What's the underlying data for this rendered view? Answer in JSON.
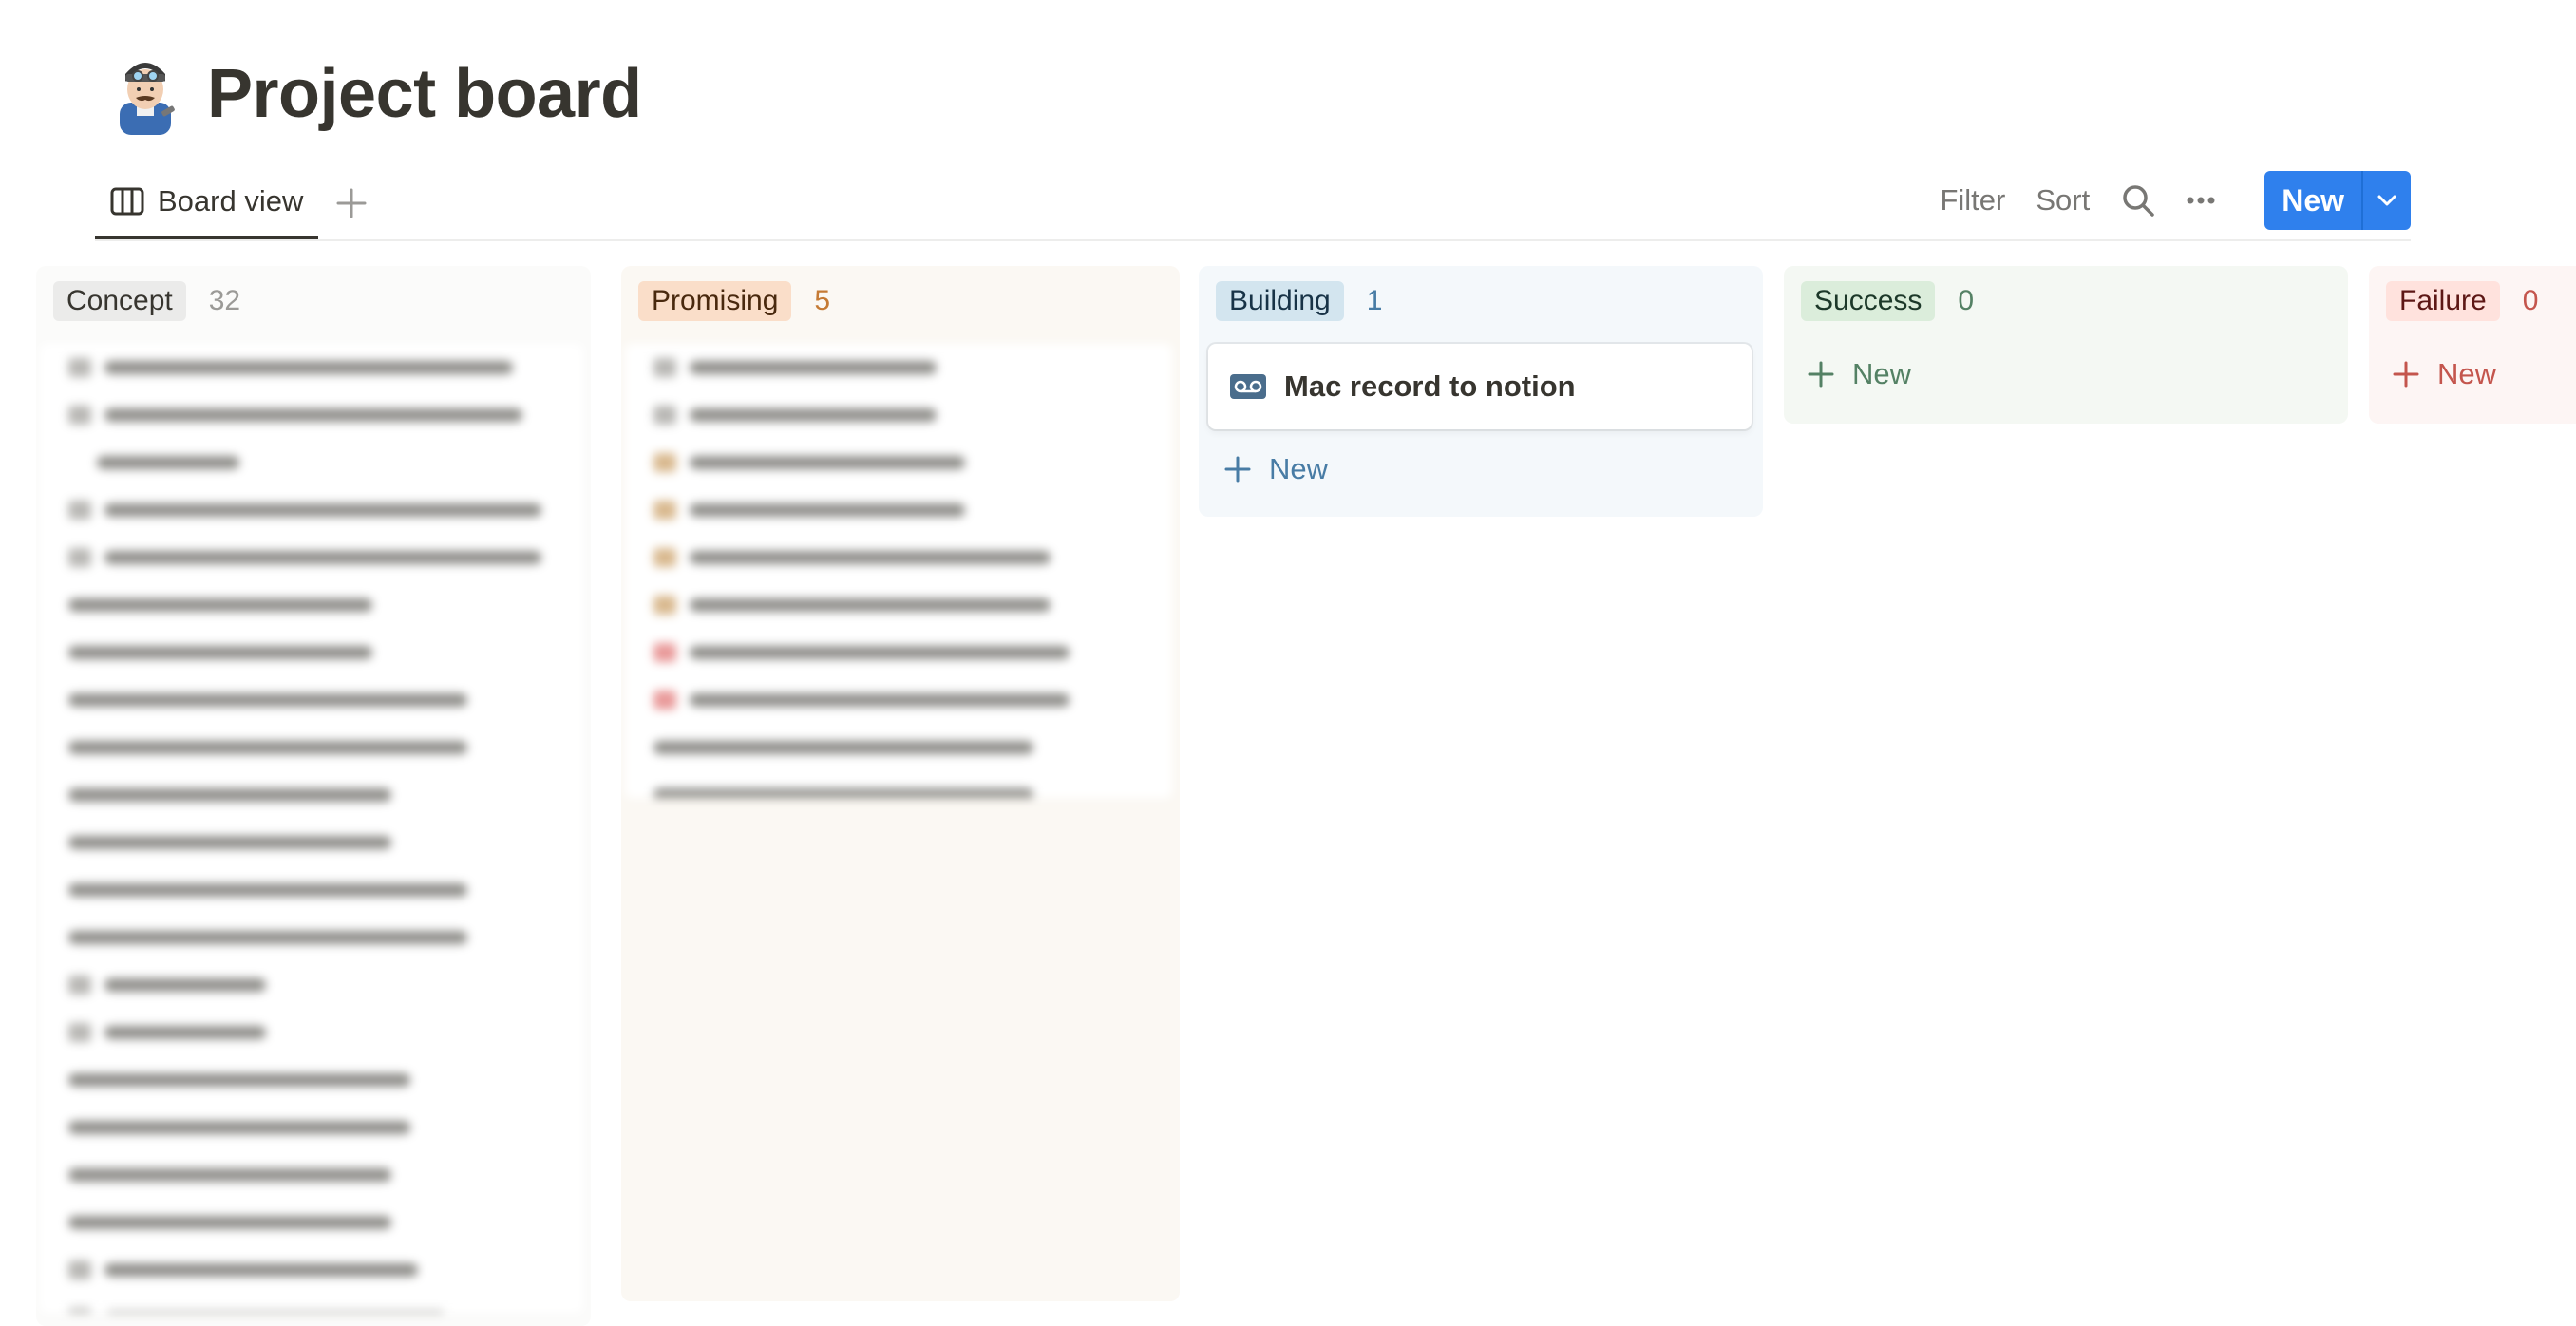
{
  "page": {
    "title": "Project board",
    "icon": "technologist-emoji-icon"
  },
  "toolbar": {
    "view_tab": "Board view",
    "filter": "Filter",
    "sort": "Sort",
    "new": "New"
  },
  "columns": [
    {
      "label": "Concept",
      "count": "32"
    },
    {
      "label": "Promising",
      "count": "5"
    },
    {
      "label": "Building",
      "count": "1",
      "cards": [
        {
          "title": "Mac record to notion",
          "icon": "voicemail-icon"
        }
      ],
      "new_label": "New"
    },
    {
      "label": "Success",
      "count": "0",
      "new_label": "New"
    },
    {
      "label": "Failure",
      "count": "0",
      "new_label": "New"
    }
  ],
  "colors": {
    "accent": "#2f80ed",
    "concept": "#ebebea",
    "promising": "#fadec9",
    "building": "#d3e5ef",
    "success": "#dbeddb",
    "failure": "#ffe2dd"
  }
}
